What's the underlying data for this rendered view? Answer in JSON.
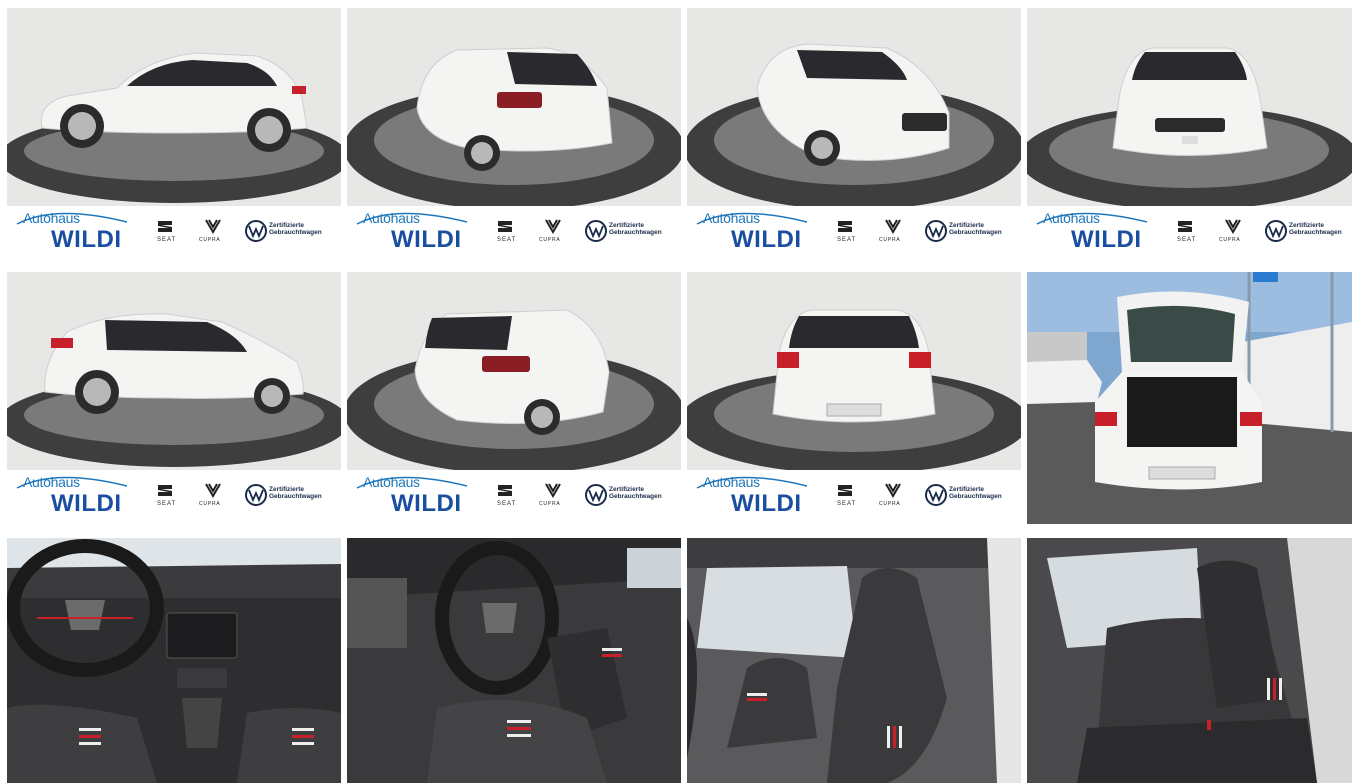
{
  "gallery": {
    "dealer_logo": {
      "prefix": "Autohaus",
      "name": "WILDI",
      "brand_1": "SEAT",
      "brand_2": "CUPRA",
      "certified_line1": "Zertifizierte",
      "certified_line2": "Gebrauchtwagen"
    },
    "photos": [
      {
        "view": "side-left"
      },
      {
        "view": "rear-left"
      },
      {
        "view": "front-left"
      },
      {
        "view": "front"
      },
      {
        "view": "side-right"
      },
      {
        "view": "rear-right"
      },
      {
        "view": "rear"
      },
      {
        "view": "open-trunk"
      },
      {
        "view": "dashboard"
      },
      {
        "view": "driver-cockpit"
      },
      {
        "view": "front-seats"
      },
      {
        "view": "rear-seats"
      }
    ],
    "colors": {
      "car_body": "#f4f4f2",
      "studio_wall": "#e6e6e4",
      "turntable": "#4a4a4a",
      "brand_blue": "#1a4ea0",
      "accent_red": "#c8202a"
    }
  }
}
